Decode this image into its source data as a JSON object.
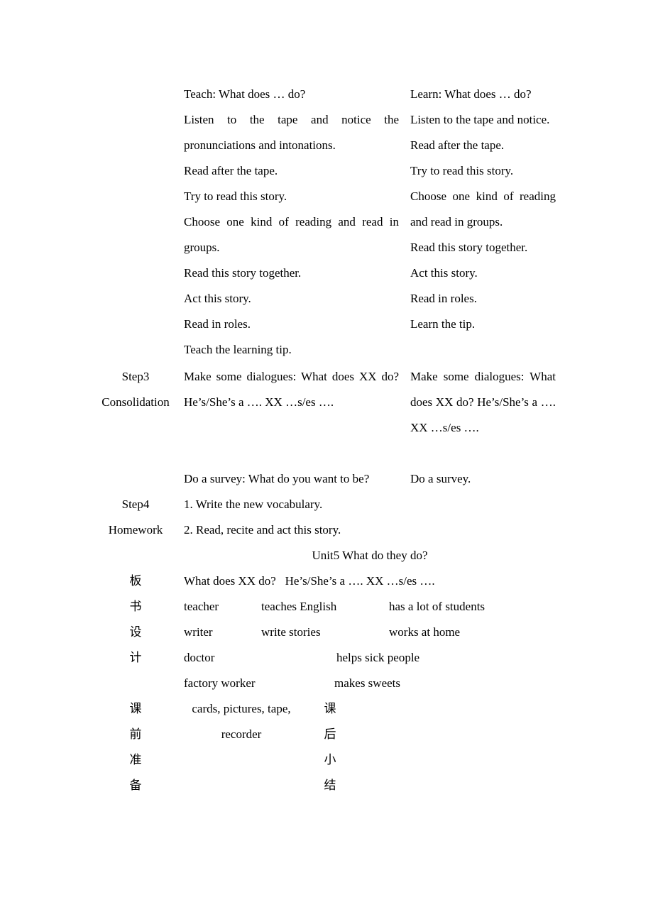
{
  "document": {
    "heading": "Unit5 What do they do?"
  },
  "lesson_table": {
    "teacher_column": [
      "Teach: What does … do?",
      "Listen to the tape and notice the pronunciations and intonations.",
      "Read after the tape.",
      "Try to read this story.",
      "Choose one kind of reading and read in groups.",
      "Read this story together.",
      "Act this story.",
      "Read in roles.",
      "Teach the learning tip.",
      "Make some dialogues: What does XX do? He’s/She’s a …. XX …s/es ….",
      "Do a survey: What do you want to be?"
    ],
    "student_column": [
      "Learn: What does … do?",
      "Listen to the tape and notice.",
      "Read after the tape.",
      "Try to read this story.",
      "Choose one kind of reading and read in groups.",
      "Read this story together.",
      "Act this story.",
      "Read in roles.",
      "Learn the tip.",
      "Make some dialogues: What does XX do? He’s/She’s a …. XX …s/es ….",
      "Do a survey."
    ]
  },
  "steps": {
    "step3_number": "Step3",
    "step3_name": "Consolidation",
    "step4_number": "Step4",
    "step4_name": "Homework"
  },
  "homework": {
    "item1": "1. Write the new vocabulary.",
    "item2": "2. Read, recite and act this story."
  },
  "board_design": {
    "label_chars": [
      "板",
      "书",
      "设",
      "计"
    ],
    "label_text": "板书设计",
    "pattern_line": "What does XX do?   He’s/She’s a …. XX …s/es ….",
    "vocabulary": [
      {
        "job": "teacher",
        "action": "teaches English",
        "detail": "has a lot of students"
      },
      {
        "job": "writer",
        "action": "write stories",
        "detail": "works at home"
      },
      {
        "job": "doctor",
        "action": "helps sick people",
        "detail": ""
      },
      {
        "job": "factory worker",
        "action": "makes sweets",
        "detail": ""
      }
    ]
  },
  "preparation": {
    "label_chars": [
      "课",
      "前",
      "准",
      "备"
    ],
    "label_text": "课前准备",
    "materials_line1": "cards, pictures, tape,",
    "materials_line2": "recorder"
  },
  "summary": {
    "label_chars": [
      "课",
      "后",
      "小",
      "结"
    ],
    "label_text": "课后小结"
  }
}
